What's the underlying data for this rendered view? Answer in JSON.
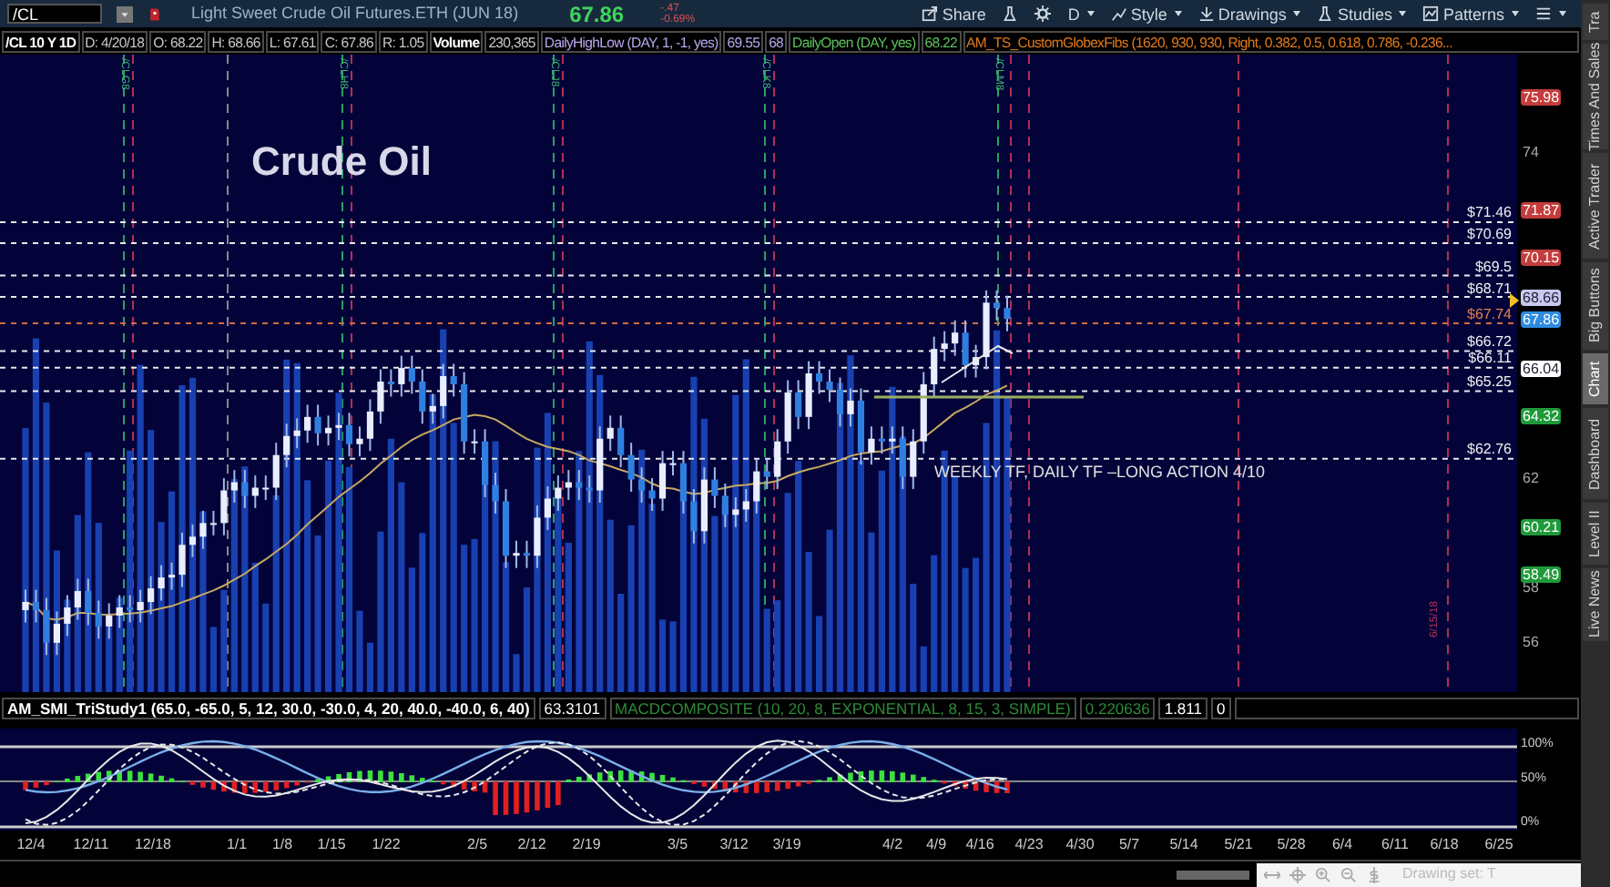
{
  "symbol_bar": {
    "symbol": "/CL",
    "description": "Light Sweet Crude Oil Futures.ETH (JUN 18)",
    "last": "67.86",
    "change": "-.47",
    "change_pct": "-0.69%"
  },
  "toolbar": [
    {
      "kind": "share",
      "label": "Share"
    },
    {
      "kind": "flask"
    },
    {
      "kind": "gear"
    },
    {
      "kind": "text",
      "label": "D"
    },
    {
      "kind": "style",
      "label": "Style"
    },
    {
      "kind": "drawings",
      "label": "Drawings"
    },
    {
      "kind": "studies",
      "label": "Studies"
    },
    {
      "kind": "patterns",
      "label": "Patterns"
    },
    {
      "kind": "menu"
    }
  ],
  "info_bar": [
    {
      "text": "/CL 10 Y 1D",
      "kind": "bold",
      "color": "#ffffff"
    },
    {
      "text": "D: 4/20/18",
      "kind": "plain",
      "color": "#c8c8c8"
    },
    {
      "text": "O: 68.22",
      "kind": "plain",
      "color": "#c8c8c8"
    },
    {
      "text": "H: 68.66",
      "kind": "plain",
      "color": "#c8c8c8"
    },
    {
      "text": "L: 67.61",
      "kind": "plain",
      "color": "#c8c8c8"
    },
    {
      "text": "C: 67.86",
      "kind": "plain",
      "color": "#c8c8c8"
    },
    {
      "text": "R: 1.05",
      "kind": "plain",
      "color": "#c8c8c8"
    },
    {
      "text": "Volume",
      "kind": "bold",
      "color": "#ffffff"
    },
    {
      "text": "230,365",
      "kind": "plain",
      "color": "#c8c8c8"
    },
    {
      "text": "DailyHighLow (DAY, 1, -1, yes)",
      "kind": "plain",
      "color": "#b9a8f0"
    },
    {
      "text": "69.55",
      "kind": "plain",
      "color": "#b9a8f0"
    },
    {
      "text": "68",
      "kind": "plain",
      "color": "#b9a8f0"
    },
    {
      "text": "DailyOpen (DAY, yes)",
      "kind": "plain",
      "color": "#5fc15f"
    },
    {
      "text": "68.22",
      "kind": "plain",
      "color": "#5fc15f"
    },
    {
      "text": "AM_TS_CustomGlobexFibs (1620, 930, 930, Right, 0.382, 0.5, 0.618, 0.786, -0.236...",
      "kind": "plain",
      "color": "#e07a1f"
    }
  ],
  "chart": {
    "title": "Crude Oil",
    "contract_labels": [
      "/CLG8",
      "/CLH8",
      "/CLJ8",
      "/CLK8",
      "/CLM8"
    ],
    "expiry_labels": [
      "6/15/18"
    ],
    "note": "WEEKLY TF, DAILY TF –LONG ACTION 4/10",
    "levels": [
      {
        "text": "$71.46",
        "kind": "fib"
      },
      {
        "text": "$70.69",
        "kind": "fib"
      },
      {
        "text": "$69.5",
        "kind": "fib"
      },
      {
        "text": "$68.71",
        "kind": "fib"
      },
      {
        "text": "$67.74",
        "kind": "open"
      },
      {
        "text": "$66.72",
        "kind": "fib"
      },
      {
        "text": "$66.11",
        "kind": "fib"
      },
      {
        "text": "$65.25",
        "kind": "fib"
      },
      {
        "text": "$62.76",
        "kind": "fib"
      }
    ],
    "price_ticks": [
      "74",
      "62",
      "58",
      "56"
    ],
    "price_badges": [
      {
        "text": "75.98",
        "color": "#c43c3c"
      },
      {
        "text": "71.87",
        "color": "#c43c3c"
      },
      {
        "text": "70.15",
        "color": "#c43c3c"
      },
      {
        "text": "68.66",
        "color": "#c8c8f0"
      },
      {
        "text": "67.86",
        "color": "#2f8be0"
      },
      {
        "text": "66.04",
        "color": "#ffffff"
      },
      {
        "text": "64.32",
        "color": "#1f9a3a"
      },
      {
        "text": "60.21",
        "color": "#1f9a3a"
      },
      {
        "text": "58.49",
        "color": "#1f9a3a"
      }
    ]
  },
  "study_header": [
    {
      "text": "AM_SMI_TriStudy1 (65.0, -65.0, 5, 12, 30.0, -30.0, 4, 20, 40.0, -40.0, 6, 40)",
      "color": "#ffffff"
    },
    {
      "text": "63.3101",
      "color": "#ffffff"
    },
    {
      "text": "MACDCOMPOSITE (10, 20, 8, EXPONENTIAL, 8, 15, 3, SIMPLE)",
      "color": "#2e8b3a"
    },
    {
      "text": "0.220636",
      "color": "#2e8b3a"
    },
    {
      "text": "1.811",
      "color": "#ffffff"
    },
    {
      "text": "0",
      "color": "#ffffff"
    }
  ],
  "study_axis": [
    "100%",
    "50%",
    "0%"
  ],
  "date_axis": [
    "12/4",
    "12/11",
    "12/18",
    "1/1",
    "1/8",
    "1/15",
    "1/22",
    "2/5",
    "2/12",
    "2/19",
    "3/5",
    "3/12",
    "3/19",
    "4/2",
    "4/9",
    "4/16",
    "4/23",
    "4/30",
    "5/7",
    "5/14",
    "5/21",
    "5/28",
    "6/4",
    "6/11",
    "6/18",
    "6/25"
  ],
  "bottom_bar": {
    "drawing_set": "Drawing set: T"
  },
  "side_tabs": [
    {
      "label": "Tra",
      "selected": false
    },
    {
      "label": "Times And Sales",
      "selected": false
    },
    {
      "label": "Active Trader",
      "selected": false
    },
    {
      "label": "Big Buttons",
      "selected": false
    },
    {
      "label": "Chart",
      "selected": true
    },
    {
      "label": "Dashboard",
      "selected": false
    },
    {
      "label": "Level II",
      "selected": false
    },
    {
      "label": "Live News",
      "selected": false
    }
  ]
}
